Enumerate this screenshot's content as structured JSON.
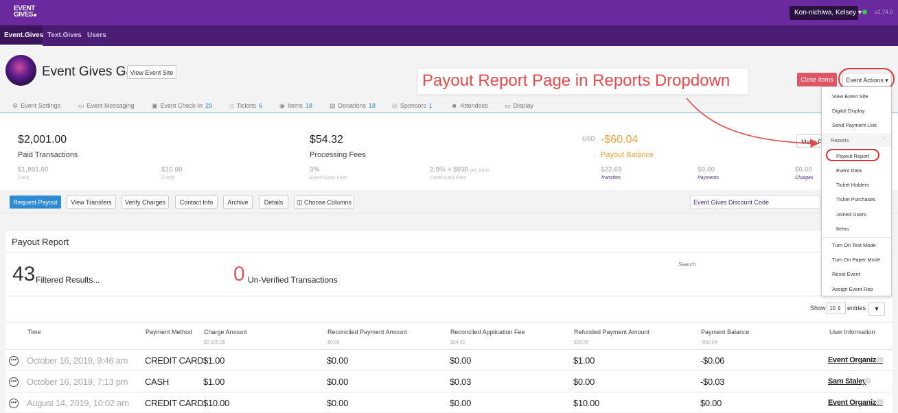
{
  "topbar": {
    "logo_line1": "EVENT",
    "logo_line2": "GIVES",
    "user_label": "Kon-nichiwa, Kelsey",
    "version": "v2.74.0"
  },
  "subnav": {
    "tabs": [
      "Event.Gives",
      "Text.Gives",
      "Users"
    ],
    "active": "Event.Gives"
  },
  "header": {
    "event_title": "Event Gives Gala",
    "view_site_label": "View Event Site",
    "close_items_label": "Close Items",
    "event_actions_label": "Event Actions"
  },
  "module_tabs": [
    {
      "label": "Event Settings",
      "icon": "gear-icon",
      "count": ""
    },
    {
      "label": "Event Messaging",
      "icon": "chat-icon",
      "count": ""
    },
    {
      "label": "Event Check-In",
      "icon": "check-icon",
      "count": "29"
    },
    {
      "label": "Tickets",
      "icon": "ticket-icon",
      "count": "6"
    },
    {
      "label": "Items",
      "icon": "item-icon",
      "count": "18"
    },
    {
      "label": "Donations",
      "icon": "donation-icon",
      "count": "18"
    },
    {
      "label": "Sponsors",
      "icon": "sponsor-icon",
      "count": "1"
    },
    {
      "label": "Attendees",
      "icon": "people-icon",
      "count": ""
    },
    {
      "label": "Display",
      "icon": "monitor-icon",
      "count": ""
    }
  ],
  "stats": {
    "paid_amount": "$2,001.00",
    "paid_label": "Paid Transactions",
    "cash_amount": "$1,991.00",
    "cash_label": "Cash",
    "credit_amount": "$10.00",
    "credit_label": "Credit",
    "fees_amount": "$54.32",
    "fees_label": "Processing Fees",
    "eg_fee_pct": "3%",
    "eg_fee_label": "Event.Gives Fees",
    "cc_fee_rate": "2.9% + $030",
    "cc_fee_rate_suffix": "per trans.",
    "cc_fee_label": "Credit Card Fees",
    "currency": "USD",
    "balance_amount": "-$60.04",
    "balance_label": "Payout Balance",
    "transfers_amount": "$22.69",
    "transfers_label": "Transfers",
    "payments_amount": "$0.00",
    "payments_label": "Payments",
    "charges_amount": "$0.00",
    "charges_label": "Charges",
    "make_payment_partial": "Make Pa"
  },
  "actionbar": {
    "buttons": [
      "Request Payout",
      "View Transfers",
      "Verify Charges",
      "Contact Info",
      "Archive",
      "Details",
      "Choose Columns"
    ],
    "discount_placeholder": "Event.Gives Discount Code"
  },
  "report": {
    "title": "Payout Report",
    "filtered_count": "43",
    "filtered_label": "Filtered Results...",
    "unverified_count": "0",
    "unverified_label": "Un-Verified Transactions",
    "search_label": "Search",
    "show_label": "Show",
    "page_size": "10",
    "entries_label": "entries",
    "columns": [
      {
        "label": "Time",
        "total": ""
      },
      {
        "label": "Payment Method",
        "total": ""
      },
      {
        "label": "Charge Amount",
        "total": "$2,029.95"
      },
      {
        "label": "Reconciled Payment Amount",
        "total": "$0.00"
      },
      {
        "label": "Reconciled Application Fee",
        "total": "$54.32"
      },
      {
        "label": "Refunded Payment Amount",
        "total": "$28.95"
      },
      {
        "label": "Payment Balance",
        "total": "-$60.04"
      },
      {
        "label": "User Information",
        "total": ""
      }
    ],
    "rows": [
      [
        "October 16, 2019, 9:46 am",
        "CREDIT CARD",
        "$1.00",
        "$0.00",
        "$0.00",
        "$1.00",
        "-$0.06",
        "Event Organizer"
      ],
      [
        "October 16, 2019, 7:13 pm",
        "CASH",
        "$1.00",
        "$0.00",
        "$0.03",
        "$0.00",
        "-$0.03",
        "Sam Staley"
      ],
      [
        "August 14, 2019, 10:02 am",
        "CREDIT CARD",
        "$10.00",
        "$0.00",
        "$0.00",
        "$10.00",
        "$0.00",
        "Event Organizer"
      ]
    ]
  },
  "dropdown": {
    "items_top": [
      "View Event Site",
      "Digital Display",
      "Send Payment Link"
    ],
    "reports_header": "Reports",
    "report_items": [
      "Payout Report",
      "Event Data",
      "Ticket Holders",
      "Ticket Purchases",
      "Joined Users",
      "Items"
    ],
    "items_bottom": [
      "Turn On Test Mode",
      "Turn On Paper Mode",
      "Reset Event",
      "Assign Event Rep"
    ]
  },
  "annotation": {
    "callout_text": "Payout Report Page in Reports Dropdown",
    "color": "#e64a4a"
  },
  "colors": {
    "brand_purple": "#6a2a9e",
    "subnav_purple": "#4b1d74",
    "primary_blue": "#2d8bd6",
    "danger_red": "#e05566",
    "balance_orange": "#f3a03a"
  }
}
